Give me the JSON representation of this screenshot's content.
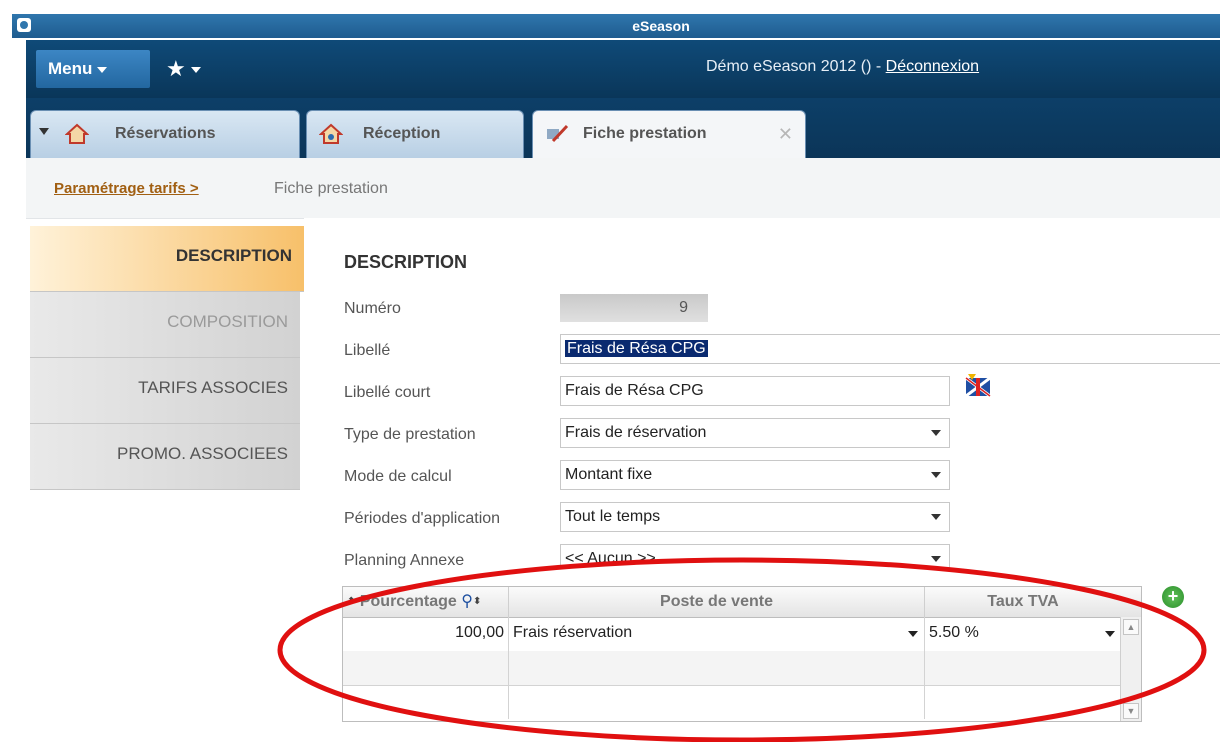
{
  "window": {
    "title": "eSeason"
  },
  "header": {
    "menu_label": "Menu",
    "favorites_label": "★",
    "user_text": "Démo eSeason 2012  () - ",
    "logout_label": "Déconnexion"
  },
  "tabs": [
    {
      "label": "Réservations"
    },
    {
      "label": "Réception"
    },
    {
      "label": "Fiche prestation",
      "close": "✕"
    }
  ],
  "breadcrumb": {
    "parent": "Paramétrage tarifs >",
    "current": "Fiche prestation"
  },
  "sidenav": {
    "items": [
      {
        "label": "DESCRIPTION"
      },
      {
        "label": "COMPOSITION"
      },
      {
        "label": "TARIFS ASSOCIES"
      },
      {
        "label": "PROMO. ASSOCIEES"
      }
    ]
  },
  "form": {
    "section_title": "DESCRIPTION",
    "numero_label": "Numéro",
    "numero_value": "9",
    "libelle_label": "Libellé",
    "libelle_value": "Frais de Résa CPG",
    "libelle_court_label": "Libellé court",
    "libelle_court_value": "Frais de Résa CPG",
    "type_label": "Type de prestation",
    "type_value": "Frais de réservation",
    "mode_label": "Mode de calcul",
    "mode_value": "Montant fixe",
    "periodes_label": "Périodes d'application",
    "periodes_value": "Tout le temps",
    "planning_label": "Planning Annexe",
    "planning_value": "<< Aucun >>"
  },
  "grid": {
    "columns": [
      "Pourcentage",
      "Poste de vente",
      "Taux TVA"
    ],
    "rows": [
      [
        "100,00",
        "Frais  réservation",
        "5.50 %"
      ]
    ]
  },
  "colors": {
    "annotation_ellipse": "#e01010",
    "header_bg": "#0f4a78",
    "active_nav": "#f7c06a"
  }
}
